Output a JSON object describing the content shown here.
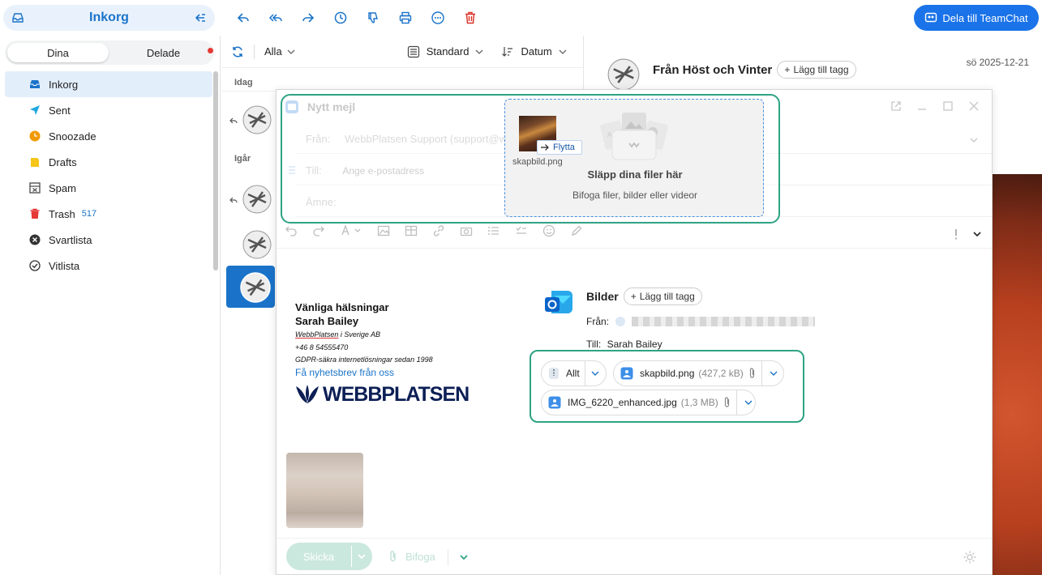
{
  "sidebar": {
    "title": "Inkorg",
    "tabs": [
      "Dina",
      "Delade"
    ],
    "items": [
      {
        "label": "Inkorg",
        "badge": ""
      },
      {
        "label": "Sent",
        "badge": ""
      },
      {
        "label": "Snoozade",
        "badge": ""
      },
      {
        "label": "Drafts",
        "badge": ""
      },
      {
        "label": "Spam",
        "badge": ""
      },
      {
        "label": "Trash",
        "badge": "517"
      },
      {
        "label": "Svartlista",
        "badge": ""
      },
      {
        "label": "Vitlista",
        "badge": ""
      }
    ]
  },
  "toolbar": {
    "teamchat_label": "Dela till TeamChat"
  },
  "list": {
    "filter": "Alla",
    "sort_view": "Standard",
    "sort_by": "Datum",
    "groups": [
      "Idag",
      "Igår"
    ]
  },
  "reading": {
    "subject": "Från Höst och Vinter",
    "tag_label": "Lägg till tagg",
    "date": "sö 2025-12-21"
  },
  "compose": {
    "title": "Nytt mejl",
    "from_label": "Från:",
    "from_value": "WebbPlatsen Support (support@w",
    "to_label": "Till:",
    "to_placeholder": "Ange e-postadress",
    "subject_label": "Ämne:",
    "drop_title": "Släpp dina filer här",
    "drop_subtitle": "Bifoga filer, bilder eller videor",
    "drag_file": "skapbild.png",
    "drag_action": "Flytta",
    "send_label": "Skicka",
    "attach_label": "Bifoga"
  },
  "signature": {
    "greeting": "Vänliga hälsningar",
    "name": "Sarah Bailey",
    "company_link": "WebbPlatsen",
    "company_rest": " i Sverige AB",
    "phone": "+46 8 54555470",
    "tagline": "GDPR-säkra internetlösningar sedan 1998",
    "newsletter": "Få nyhetsbrev från oss",
    "logo_text": "WEBBPLATSEN"
  },
  "quoted": {
    "title": "Bilder",
    "tag_label": "Lägg till tagg",
    "from_label": "Från:",
    "to_label": "Till:",
    "to_value": "Sarah Bailey",
    "all_label": "Allt",
    "attachments": [
      {
        "name": "skapbild.png",
        "size": "(427,2 kB)"
      },
      {
        "name": "IMG_6220_enhanced.jpg",
        "size": "(1,3 MB)"
      }
    ]
  },
  "colors": {
    "accent": "#1a73c9",
    "highlight": "#2ea385",
    "teamchat": "#1a73e8"
  }
}
